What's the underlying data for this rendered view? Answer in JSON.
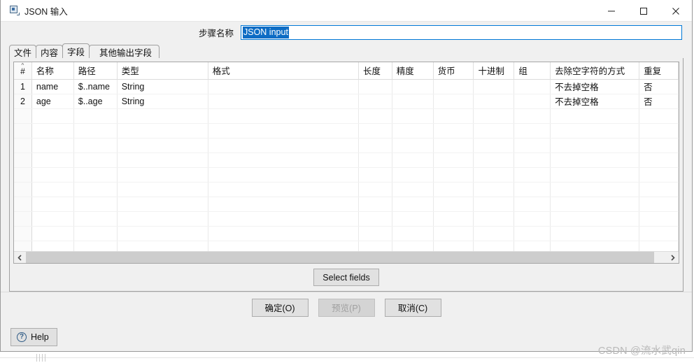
{
  "window": {
    "title": "JSON 输入",
    "icon": "json-input-app-icon",
    "controls": {
      "minimize": "minimize-icon",
      "maximize": "maximize-icon",
      "close": "close-icon"
    }
  },
  "step": {
    "label": "步骤名称",
    "value": "JSON input",
    "placeholder": ""
  },
  "tabs": [
    {
      "label": "文件",
      "active": false
    },
    {
      "label": "内容",
      "active": false
    },
    {
      "label": "字段",
      "active": true
    },
    {
      "label": "其他输出字段",
      "active": false
    }
  ],
  "table": {
    "columns": [
      {
        "key": "num",
        "label": "#"
      },
      {
        "key": "name",
        "label": "名称"
      },
      {
        "key": "path",
        "label": "路径"
      },
      {
        "key": "type",
        "label": "类型"
      },
      {
        "key": "format",
        "label": "格式"
      },
      {
        "key": "length",
        "label": "长度"
      },
      {
        "key": "precision",
        "label": "精度"
      },
      {
        "key": "currency",
        "label": "货币"
      },
      {
        "key": "decimal",
        "label": "十进制"
      },
      {
        "key": "group",
        "label": "组"
      },
      {
        "key": "trim",
        "label": "去除空字符的方式"
      },
      {
        "key": "repeat",
        "label": "重复"
      }
    ],
    "rows": [
      {
        "num": "1",
        "name": "name",
        "path": "$..name",
        "type": "String",
        "format": "",
        "length": "",
        "precision": "",
        "currency": "",
        "decimal": "",
        "group": "",
        "trim": "不去掉空格",
        "repeat": "否"
      },
      {
        "num": "2",
        "name": "age",
        "path": "$..age",
        "type": "String",
        "format": "",
        "length": "",
        "precision": "",
        "currency": "",
        "decimal": "",
        "group": "",
        "trim": "不去掉空格",
        "repeat": "否"
      }
    ],
    "empty_row_count": 11,
    "sort_indicator": "sort-ascending-caret"
  },
  "scrollbar": {
    "left_arrow": "chevron-left-icon",
    "right_arrow": "chevron-right-icon"
  },
  "buttons": {
    "select_fields": "Select fields",
    "ok": "确定(O)",
    "preview": "预览(P)",
    "preview_disabled": true,
    "cancel": "取消(C)",
    "help": "Help",
    "help_icon": "question-circle-icon"
  },
  "watermark": "CSDN @流水武qin",
  "colors": {
    "accent": "#0078d7",
    "selection": "#0d6cc4",
    "dialog_bg": "#f0f0f0",
    "border": "#a0a0a0",
    "watermark": "#b9b9b9"
  }
}
